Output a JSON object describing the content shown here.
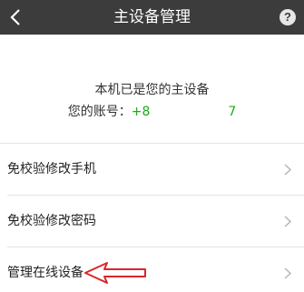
{
  "nav": {
    "title": "主设备管理",
    "back_icon": "chevron-left-icon",
    "help_icon": "question-mark-icon",
    "help_symbol": "?"
  },
  "device_info": {
    "primary_text": "本机已是您的主设备",
    "account_label": "您的账号：",
    "account_value_start": "+8",
    "account_value_end": "7"
  },
  "list": {
    "items": [
      {
        "label": "免校验修改手机"
      },
      {
        "label": "免校验修改密码"
      },
      {
        "label": "管理在线设备"
      }
    ]
  },
  "colors": {
    "nav_background": "#3c3c3c",
    "account_highlight": "#1aad19",
    "annotation_arrow": "#d9262c"
  }
}
